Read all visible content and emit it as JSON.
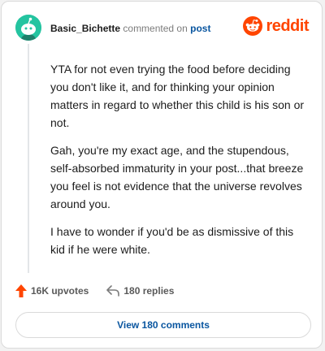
{
  "comment": {
    "author": "Basic_Bichette",
    "action_text": "commented on",
    "post_link": "post",
    "paragraphs": [
      "YTA for not even trying the food before deciding you don't like it, and for thinking your opinion matters in regard to whether this child is his son or not.",
      "Gah, you're my exact age, and the stupendous, self-absorbed immaturity in your post...that breeze you feel is not evidence that the universe revolves around you.",
      "I have to wonder if you'd be as dismissive of this kid if he were white."
    ]
  },
  "brand": {
    "name": "reddit",
    "color": "#ff4500"
  },
  "actions": {
    "upvotes": "16K upvotes",
    "replies": "180 replies"
  },
  "view_button": {
    "label": "View 180 comments"
  },
  "colors": {
    "avatar_bg": "#24c4a0",
    "link": "#0a56a0",
    "upvote": "#ff4500"
  },
  "icons": [
    "avatar-icon",
    "reddit-logo-icon",
    "upvote-arrow-icon",
    "reply-icon"
  ]
}
